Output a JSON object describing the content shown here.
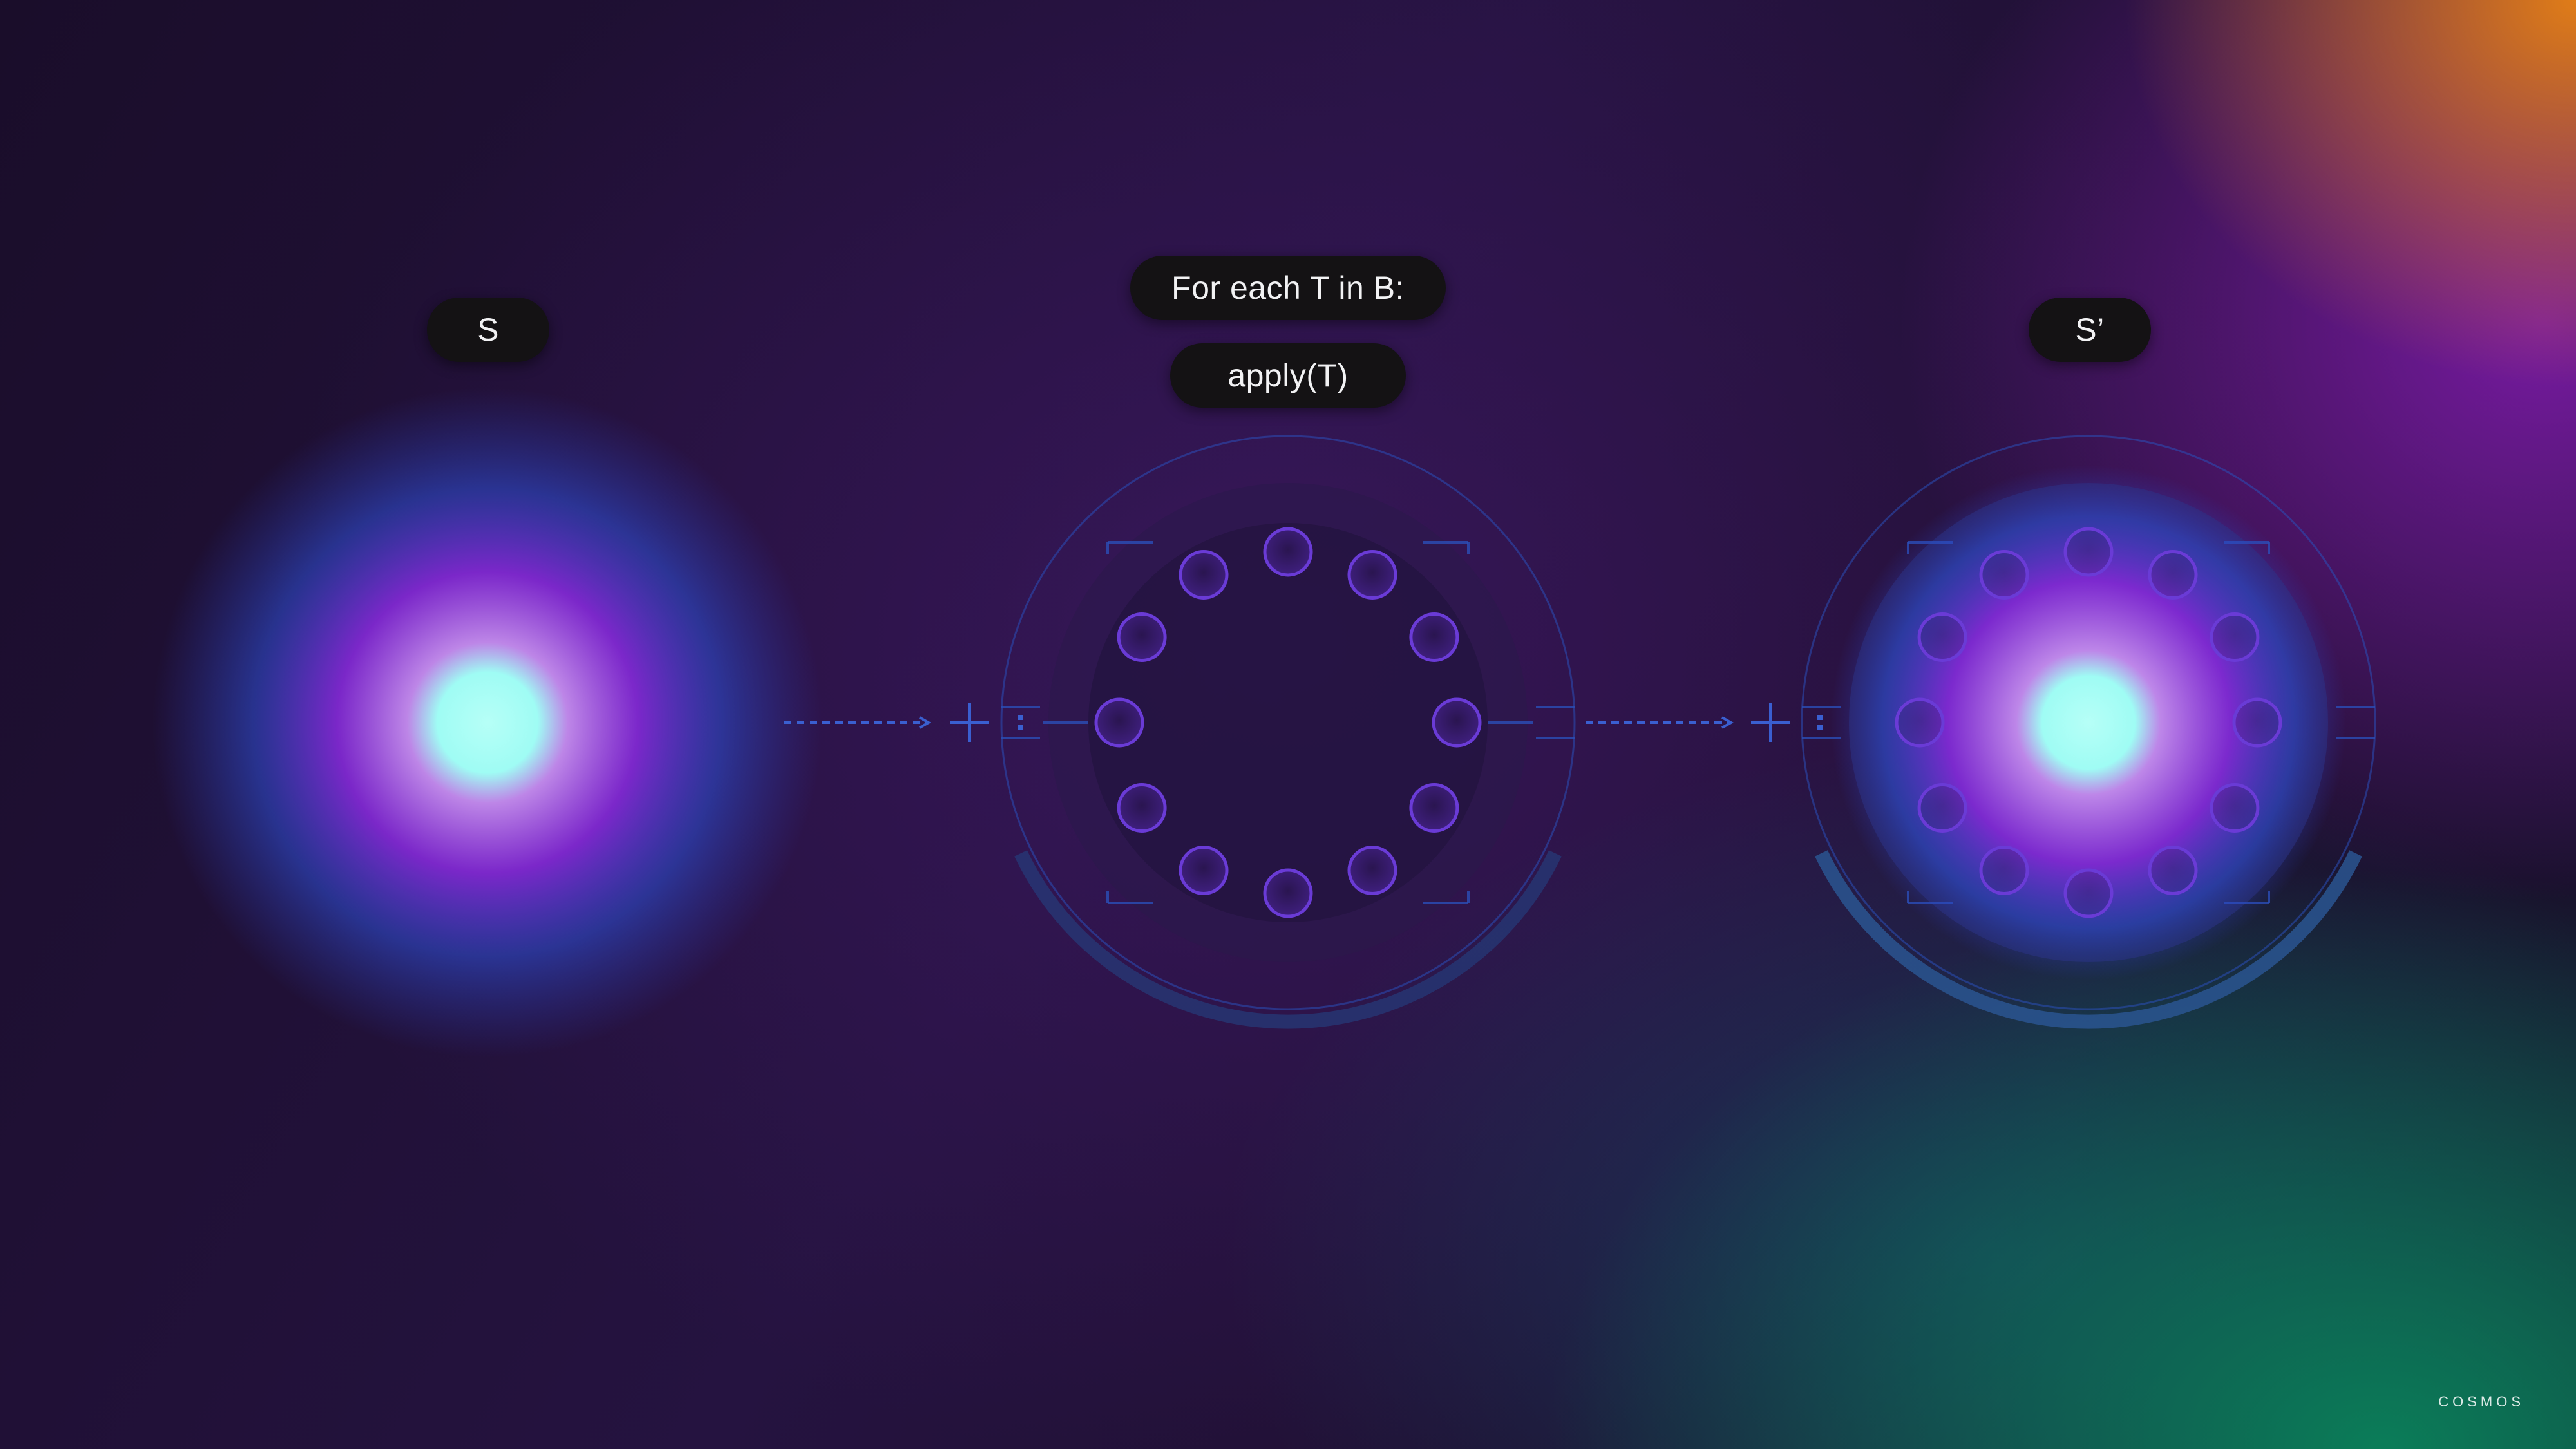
{
  "labels": {
    "initial_state": "S",
    "loop_header": "For each T in B:",
    "loop_body": "apply(T)",
    "final_state": "S’"
  },
  "brand": {
    "text": "COSMOS"
  },
  "transactions": {
    "count": 12
  },
  "colors": {
    "glow_core": "#a8fff4",
    "glow_mid": "#8a2be2",
    "glow_outer": "#2a4fd6",
    "ring_stroke": "#2a4fb8",
    "node_stroke": "#6a3bd6",
    "pill_bg": "#141214",
    "pill_text": "#f2f2f4"
  },
  "icons": [
    "dashed-arrow-icon",
    "crosshair-plus-icon"
  ]
}
